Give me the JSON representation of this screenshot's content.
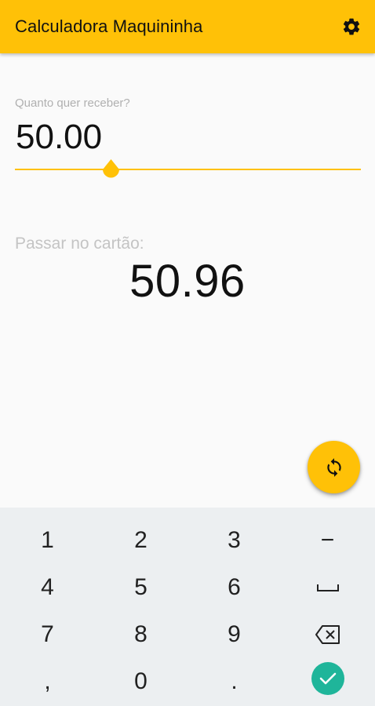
{
  "appbar": {
    "title": "Calculadora Maquininha",
    "settings_icon": "gear-icon",
    "color": "#ffc107"
  },
  "input": {
    "label": "Quanto quer receber?",
    "value": "50.00",
    "accent_color": "#ffc107"
  },
  "result": {
    "label": "Passar no cartão:",
    "value": "50.96"
  },
  "fab": {
    "icon": "refresh-icon"
  },
  "keyboard": {
    "row1": [
      "1",
      "2",
      "3",
      "−"
    ],
    "row2": [
      "4",
      "5",
      "6",
      "␣"
    ],
    "row3": [
      "7",
      "8",
      "9",
      "backspace-icon"
    ],
    "row4": [
      ",",
      "0",
      ".",
      "done-icon"
    ],
    "done_color": "#1fb59a"
  }
}
